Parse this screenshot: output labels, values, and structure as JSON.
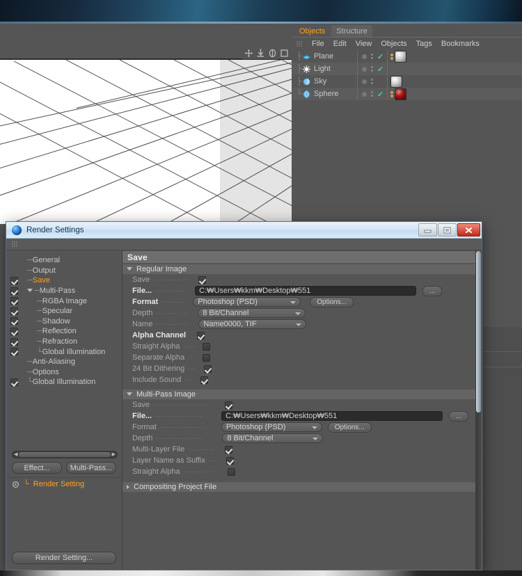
{
  "desktop": {
    "wallpaper": "#16293c"
  },
  "viewport": {
    "toolbar_icons": [
      "move-icon",
      "pan-icon",
      "rotate-icon",
      "frame-icon"
    ],
    "background": "#ffffff",
    "shade_band": "#e4e4e4"
  },
  "objects_panel": {
    "tabs": [
      {
        "label": "Objects",
        "active": true
      },
      {
        "label": "Structure",
        "active": false
      }
    ],
    "menu": [
      "File",
      "Edit",
      "View",
      "Objects",
      "Tags",
      "Bookmarks"
    ],
    "rows": [
      {
        "name": "Plane",
        "type_icon": "plane-icon",
        "visible_check": true,
        "has_tags": true,
        "material": "#d8d8d8"
      },
      {
        "name": "Light",
        "type_icon": "light-icon",
        "visible_check": true,
        "has_tags": false,
        "material": ""
      },
      {
        "name": "Sky",
        "type_icon": "sky-icon",
        "visible_check": false,
        "has_tags": false,
        "material": "#d8d8d8"
      },
      {
        "name": "Sphere",
        "type_icon": "sphere-icon",
        "visible_check": true,
        "has_tags": true,
        "material": "#8e1010"
      }
    ]
  },
  "dialog": {
    "title": "Render Settings",
    "window_buttons": {
      "minimize": "minimize-icon",
      "maximize": "maximize-icon",
      "close": "close-icon"
    },
    "tree": {
      "items": [
        {
          "label": "General",
          "checkbox": null,
          "indent": 1,
          "selected": false,
          "twisty": ""
        },
        {
          "label": "Output",
          "checkbox": null,
          "indent": 1,
          "selected": false,
          "twisty": ""
        },
        {
          "label": "Save",
          "checkbox": true,
          "indent": 1,
          "selected": true,
          "twisty": ""
        },
        {
          "label": "Multi-Pass",
          "checkbox": true,
          "indent": 1,
          "selected": false,
          "twisty": "down"
        },
        {
          "label": "RGBA Image",
          "checkbox": true,
          "indent": 2,
          "selected": false,
          "twisty": ""
        },
        {
          "label": "Specular",
          "checkbox": true,
          "indent": 2,
          "selected": false,
          "twisty": ""
        },
        {
          "label": "Shadow",
          "checkbox": true,
          "indent": 2,
          "selected": false,
          "twisty": ""
        },
        {
          "label": "Reflection",
          "checkbox": true,
          "indent": 2,
          "selected": false,
          "twisty": ""
        },
        {
          "label": "Refraction",
          "checkbox": true,
          "indent": 2,
          "selected": false,
          "twisty": ""
        },
        {
          "label": "Global Illumination",
          "checkbox": true,
          "indent": 2,
          "selected": false,
          "twisty": ""
        },
        {
          "label": "Anti-Aliasing",
          "checkbox": null,
          "indent": 1,
          "selected": false,
          "twisty": ""
        },
        {
          "label": "Options",
          "checkbox": null,
          "indent": 1,
          "selected": false,
          "twisty": ""
        },
        {
          "label": "Global Illumination",
          "checkbox": true,
          "indent": 1,
          "selected": false,
          "twisty": ""
        }
      ],
      "buttons": {
        "effect": "Effect...",
        "multipass": "Multi-Pass..."
      },
      "render_setting_item": "Render Setting",
      "footer_button": "Render Setting..."
    },
    "settings": {
      "header": "Save",
      "regular_image": {
        "group_label": "Regular Image",
        "expanded": true,
        "save_label": "Save",
        "save_checked": true,
        "file_label": "File...",
        "file_value": "C:₩Users₩kkm₩Desktop₩551",
        "file_browse": "...",
        "format_label": "Format",
        "format_value": "Photoshop (PSD)",
        "options_button": "Options...",
        "depth_label": "Depth",
        "depth_value": "8 Bit/Channel",
        "name_label": "Name",
        "name_value": "Name0000, TIF",
        "alpha_channel_label": "Alpha Channel",
        "alpha_channel_checked": true,
        "straight_alpha_label": "Straight Alpha",
        "straight_alpha_checked": false,
        "separate_alpha_label": "Separate Alpha",
        "separate_alpha_checked": false,
        "dithering_label": "24 Bit Dithering",
        "dithering_checked": true,
        "include_sound_label": "Include Sound",
        "include_sound_checked": true
      },
      "multipass_image": {
        "group_label": "Multi-Pass Image",
        "expanded": true,
        "save_label": "Save",
        "save_checked": true,
        "file_label": "File...",
        "file_value": "C:₩Users₩kkm₩Desktop₩551",
        "file_browse": "...",
        "format_label": "Format",
        "format_value": "Photoshop (PSD)",
        "options_button": "Options...",
        "depth_label": "Depth",
        "depth_value": "8 Bit/Channel",
        "multilayer_label": "Multi-Layer File",
        "multilayer_checked": true,
        "layersuffix_label": "Layer Name as Suffix",
        "layersuffix_checked": true,
        "straight_alpha_label": "Straight Alpha",
        "straight_alpha_checked": false
      },
      "compositing": {
        "group_label": "Compositing Project File",
        "expanded": false
      }
    }
  },
  "colors": {
    "accent_orange": "#ffa022",
    "panel_gray": "#555555",
    "group_header": "#646464",
    "field_dark": "#2b2b2b",
    "check_green": "#4fd08a"
  }
}
